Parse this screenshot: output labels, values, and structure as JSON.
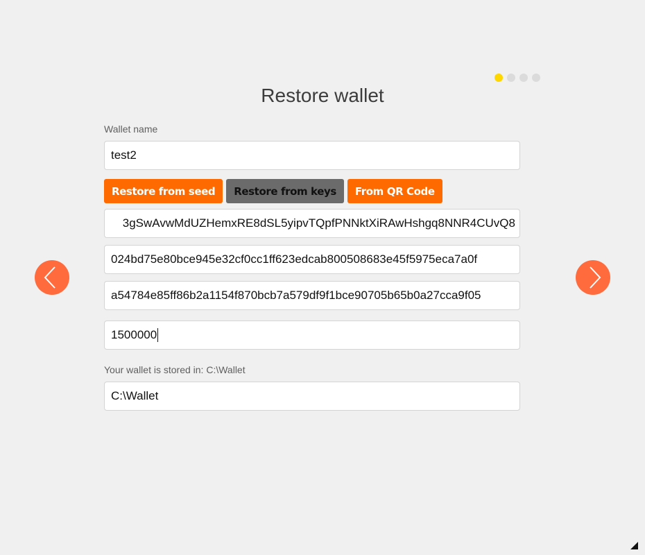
{
  "pagination": {
    "steps": [
      {
        "active": true
      },
      {
        "active": false
      },
      {
        "active": false
      },
      {
        "active": false
      }
    ],
    "active_color": "#ffd700",
    "inactive_color": "#dbdbdb"
  },
  "header": {
    "title": "Restore wallet"
  },
  "wallet_name": {
    "label": "Wallet name",
    "value": "test2"
  },
  "restore_modes": {
    "seed_label": "Restore from seed",
    "keys_label": "Restore from keys",
    "qr_label": "From QR Code",
    "selected": "keys",
    "accent_color": "#ff6a00",
    "selected_color": "#6b6b6b"
  },
  "keys": {
    "address": "3gSwAvwMdUZHemxRE8dSL5yipvTQpfPNNktXiRAwHshgq8NNR4CUvQ8",
    "view_key": "024bd75e80bce945e32cf0cc1ff623edcab800508683e45f5975eca7a0f",
    "spend_key": "a54784e85ff86b2a1154f870bcb7a579df9f1bce90705b65b0a27cca9f05"
  },
  "restore_height": {
    "value": "1500000"
  },
  "storage": {
    "label": "Your wallet is stored in: C:\\Wallet",
    "path": "C:\\Wallet"
  },
  "navigation": {
    "prev_icon": "chevron-left",
    "next_icon": "chevron-right",
    "color": "#ff6b3d"
  }
}
